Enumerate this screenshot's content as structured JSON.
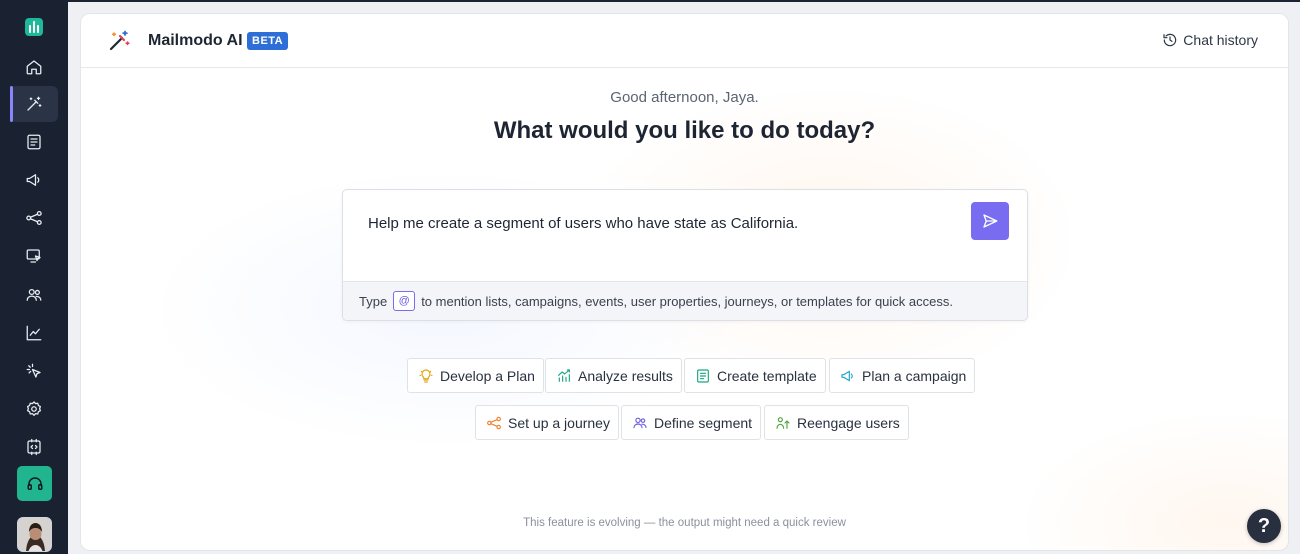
{
  "sidebar": {
    "logo": "mailmodo-logo-icon",
    "items": [
      {
        "name": "home",
        "icon": "home-icon"
      },
      {
        "name": "ai",
        "icon": "magic-wand-icon",
        "active": true
      },
      {
        "name": "templates",
        "icon": "document-icon"
      },
      {
        "name": "campaigns",
        "icon": "megaphone-icon"
      },
      {
        "name": "journeys",
        "icon": "share-nodes-icon"
      },
      {
        "name": "widgets",
        "icon": "monitor-click-icon"
      },
      {
        "name": "audience",
        "icon": "users-icon"
      },
      {
        "name": "analytics",
        "icon": "line-chart-icon"
      },
      {
        "name": "events",
        "icon": "cursor-click-icon"
      },
      {
        "name": "settings",
        "icon": "gear-icon"
      },
      {
        "name": "developer",
        "icon": "code-icon"
      }
    ],
    "support_icon": "headset-icon",
    "avatar": "user-avatar"
  },
  "header": {
    "brand": "Mailmodo AI",
    "badge": "BETA",
    "chat_history": "Chat history"
  },
  "main": {
    "greeting": "Good afternoon, Jaya.",
    "headline": "What would you like to do today?",
    "prompt": {
      "value": "Help me create a segment of users who have state as California.",
      "hint_prefix": "Type",
      "hint_at": "@",
      "hint_suffix": "to mention lists, campaigns, events, user properties, journeys, or templates for quick access."
    },
    "suggestions_row1": [
      {
        "label": "Develop a Plan",
        "icon": "lightbulb-icon"
      },
      {
        "label": "Analyze results",
        "icon": "bar-trend-icon"
      },
      {
        "label": "Create template",
        "icon": "template-icon"
      },
      {
        "label": "Plan a campaign",
        "icon": "megaphone-icon"
      }
    ],
    "suggestions_row2": [
      {
        "label": "Set up a journey",
        "icon": "share-nodes-icon"
      },
      {
        "label": "Define segment",
        "icon": "users-icon"
      },
      {
        "label": "Reengage users",
        "icon": "user-arrow-icon"
      }
    ],
    "disclaimer": "This feature is evolving — the output might need a quick review"
  },
  "help": "?",
  "colors": {
    "sidebar_bg": "#1a2130",
    "accent": "#7a6cf0",
    "beta_badge": "#2d6fd6",
    "support_green": "#20b58f"
  }
}
